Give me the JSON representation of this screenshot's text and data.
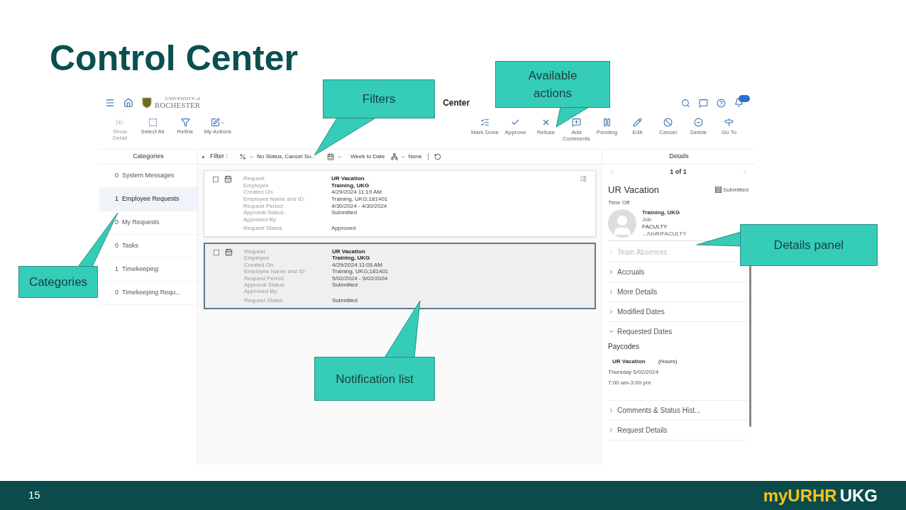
{
  "slide": {
    "title": "Control Center",
    "page_number": "15",
    "logo": {
      "primary": "myURHR",
      "secondary": "UKG"
    }
  },
  "app": {
    "header": {
      "logo_small": "UNIVERSITY of",
      "logo_text": "ROCHESTER",
      "title": "Center"
    },
    "toolbar_left": [
      {
        "kind": "show",
        "label": "Show Detail",
        "disabled": true
      },
      {
        "kind": "select",
        "label": "Select All",
        "disabled": false
      },
      {
        "kind": "refine",
        "label": "Refine",
        "disabled": false
      },
      {
        "kind": "actions",
        "label": "My Actions",
        "disabled": false
      }
    ],
    "toolbar_right": [
      {
        "kind": "done",
        "label": "Mark Done"
      },
      {
        "kind": "approve",
        "label": "Approve"
      },
      {
        "kind": "refuse",
        "label": "Refuse"
      },
      {
        "kind": "comment",
        "label": "Add Comments"
      },
      {
        "kind": "pending",
        "label": "Pending"
      },
      {
        "kind": "edit",
        "label": "Edit"
      },
      {
        "kind": "cancel",
        "label": "Cancel"
      },
      {
        "kind": "delete",
        "label": "Delete"
      },
      {
        "kind": "goto",
        "label": "Go To"
      }
    ],
    "categories_header": "Categories",
    "details_header": "Details",
    "filter": {
      "label": "Filter :",
      "status": "No Status, Cancel Su...",
      "period": "Week to Date",
      "group": "None"
    },
    "categories": [
      {
        "count": "0",
        "label": "System Messages",
        "selected": false
      },
      {
        "count": "1",
        "label": "Employee Requests",
        "selected": true
      },
      {
        "count": "0",
        "label": "My Requests",
        "selected": false
      },
      {
        "count": "0",
        "label": "Tasks",
        "selected": false
      },
      {
        "count": "1",
        "label": "Timekeeping",
        "selected": false
      },
      {
        "count": "0",
        "label": "Timekeeping Requ...",
        "selected": false
      }
    ],
    "notifications": [
      {
        "selected": false,
        "checked": false,
        "fields": [
          {
            "label": "Request",
            "value": "UR Vacation"
          },
          {
            "label": "Employee",
            "value": "Training, UKG"
          },
          {
            "label": "Created On",
            "value": "4/29/2024 11:19 AM"
          },
          {
            "label": "Employee Name and ID:",
            "value": "Training, UKG;181401"
          },
          {
            "label": "Request Period:",
            "value": "4/30/2024 - 4/30/2024"
          },
          {
            "label": "Approval Status:",
            "value": "Submitted"
          },
          {
            "label": "Approved By:"
          },
          {
            "label": "Request Status",
            "value": "Approved"
          }
        ]
      },
      {
        "selected": true,
        "checked": false,
        "fields": [
          {
            "label": "Request",
            "value": "UR Vacation"
          },
          {
            "label": "Employee",
            "value": "Training, UKG"
          },
          {
            "label": "Created On",
            "value": "4/29/2024 11:05 AM"
          },
          {
            "label": "Employee Name and ID:",
            "value": "Training, UKG;181401"
          },
          {
            "label": "Request Period:",
            "value": "5/02/2024 - 5/02/2024"
          },
          {
            "label": "Approval Status:",
            "value": "Submitted"
          },
          {
            "label": "Approved By:"
          },
          {
            "label": "Request Status",
            "value": "Submitted"
          }
        ]
      }
    ],
    "details": {
      "pager": "1 of 1",
      "title": "UR Vacation",
      "status": "Submitted",
      "subtitle": "Time Off",
      "employee": {
        "name": "Training, UKG",
        "job_label": "Job",
        "job": "FACULTY",
        "path": ".../UnR/FACULTY"
      },
      "sections": [
        {
          "label": "Team Absences",
          "disabled": true,
          "expanded": false
        },
        {
          "label": "Accruals",
          "disabled": false,
          "expanded": false
        },
        {
          "label": "More Details",
          "disabled": false,
          "expanded": false
        },
        {
          "label": "Modified Dates",
          "disabled": false,
          "expanded": false
        },
        {
          "label": "Requested Dates",
          "disabled": false,
          "expanded": true,
          "content": {
            "heading": "Paycodes",
            "paycode": "UR Vacation",
            "unit": "(Hours)",
            "date": "Thursday 5/02/2024",
            "time": "7:00 am-3:00 pm"
          }
        },
        {
          "label": "Comments & Status Hist...",
          "disabled": false,
          "expanded": false
        },
        {
          "label": "Request Details",
          "disabled": false,
          "expanded": false
        }
      ]
    }
  },
  "callouts": [
    {
      "kind": "filters",
      "text": "Filters"
    },
    {
      "kind": "actions",
      "text": "Available actions"
    },
    {
      "kind": "categories",
      "text": "Categories"
    },
    {
      "kind": "details",
      "text": "Details panel"
    },
    {
      "kind": "list",
      "text": "Notification list"
    }
  ]
}
